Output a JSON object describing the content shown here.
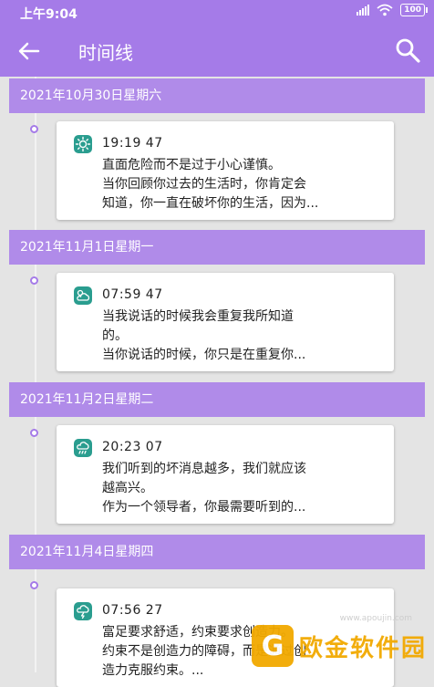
{
  "status": {
    "time": "上午9:04",
    "battery": "100"
  },
  "appbar": {
    "title": "时间线",
    "back_icon": "back-arrow-icon",
    "search_icon": "search-icon"
  },
  "colors": {
    "accent": "#a57be8",
    "header": "#b08be9",
    "icon": "#2a9d8f",
    "background": "#e4e4e4"
  },
  "entries": [
    {
      "date": "2021年10月30日星期六",
      "icon": "sun-icon",
      "time": "19:19 47",
      "lines": [
        "直面危险而不是过于小心谨慎。",
        "当你回顾你过去的生活时，你肯定会",
        "知道，你一直在破坏你的生活，因为..."
      ]
    },
    {
      "date": "2021年11月1日星期一",
      "icon": "cloudy-icon",
      "time": "07:59 47",
      "lines": [
        "当我说话的时候我会重复我所知道",
        "的。",
        "当你说话的时候，你只是在重复你..."
      ]
    },
    {
      "date": "2021年11月2日星期二",
      "icon": "rain-icon",
      "time": "20:23 07",
      "lines": [
        "我们听到的坏消息越多，我们就应该",
        "越高兴。",
        "作为一个领导者，你最需要听到的..."
      ]
    },
    {
      "date": "2021年11月4日星期四",
      "icon": "storm-icon",
      "time": "07:56 27",
      "lines": [
        "富足要求舒适，约束要求创造力。",
        "约束不是创造力的障碍，而是通过创",
        "造力克服约束。..."
      ]
    }
  ],
  "watermark": {
    "logo": "G",
    "text": "欧金软件园",
    "url": "www.apoujin.com"
  }
}
